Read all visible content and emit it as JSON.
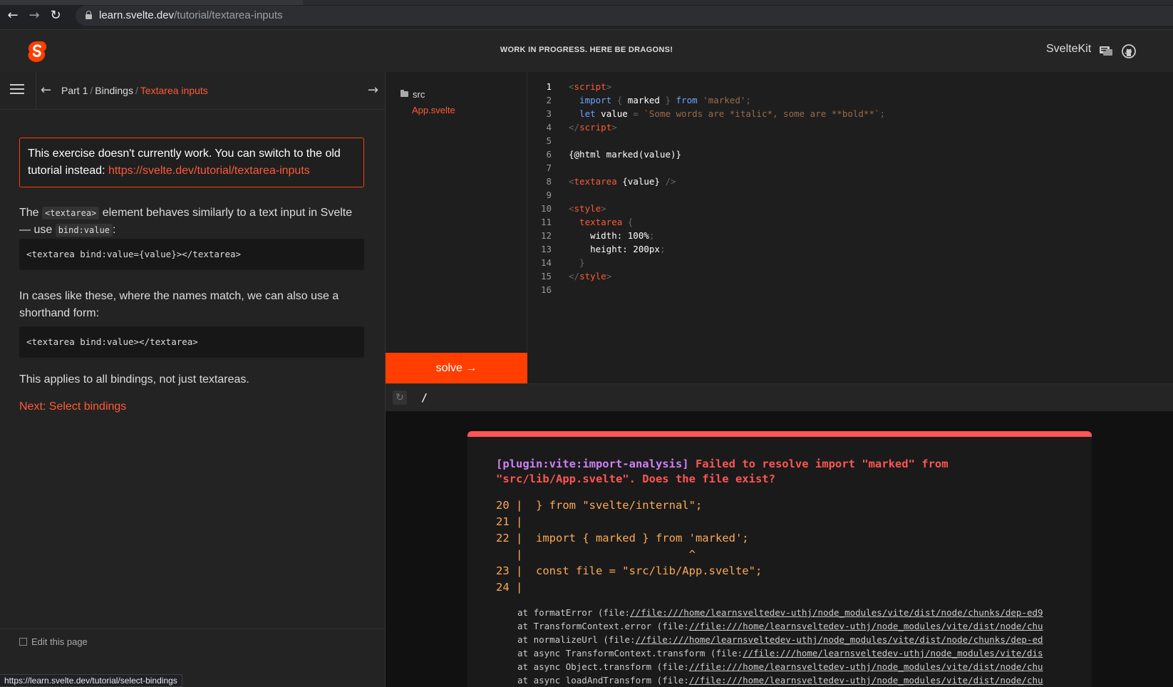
{
  "browser": {
    "url_host": "learn.svelte.dev",
    "url_path": "/tutorial/textarea-inputs",
    "status_url": "https://learn.svelte.dev/tutorial/select-bindings"
  },
  "header": {
    "banner": "WORK IN PROGRESS. HERE BE DRAGONS!",
    "sveltekit_label": "SvelteKit"
  },
  "breadcrumb": {
    "part": "Part 1",
    "section": "Bindings",
    "current": "Textarea inputs"
  },
  "lesson": {
    "warning_text": "This exercise doesn't currently work. You can switch to the old tutorial instead: ",
    "warning_link": "https://svelte.dev/tutorial/textarea-inputs",
    "p1_before": "The ",
    "p1_code1": "<textarea>",
    "p1_mid": " element behaves similarly to a text input in Svelte — use ",
    "p1_code2": "bind:value",
    "p1_after": ":",
    "code1": "<textarea bind:value={value}></textarea>",
    "p2": "In cases like these, where the names match, we can also use a shorthand form:",
    "code2": "<textarea bind:value></textarea>",
    "p3": "This applies to all bindings, not just textareas.",
    "next": "Next: Select bindings",
    "edit": "Edit this page"
  },
  "filetree": {
    "folder": "src",
    "file": "App.svelte",
    "solve": "solve →"
  },
  "editor": {
    "line_numbers": [
      "1",
      "2",
      "3",
      "4",
      "5",
      "6",
      "7",
      "8",
      "9",
      "10",
      "11",
      "12",
      "13",
      "14",
      "15",
      "16"
    ],
    "l1a": "<",
    "l1b": "script",
    "l1c": ">",
    "l2a": "  import",
    "l2b": " { ",
    "l2c": "marked",
    "l2d": " } ",
    "l2e": "from",
    "l2f": " 'marked'",
    "l2g": ";",
    "l3a": "  let",
    "l3b": " value",
    "l3c": " = ",
    "l3d": "`Some words are *italic*, some are **bold**`",
    "l3e": ";",
    "l4a": "</",
    "l4b": "script",
    "l4c": ">",
    "l6": "{@html marked(value)}",
    "l8a": "<",
    "l8b": "textarea",
    "l8c": " {value} ",
    "l8d": "/>",
    "l10a": "<",
    "l10b": "style",
    "l10c": ">",
    "l11a": "  textarea",
    "l11b": " {",
    "l12a": "    width: 100%",
    "l12b": ";",
    "l13a": "    height: 200px",
    "l13b": ";",
    "l14": "  }",
    "l15a": "</",
    "l15b": "style",
    "l15c": ">"
  },
  "preview": {
    "path": "/",
    "plugin": "[plugin:vite:import-analysis]",
    "message": " Failed to resolve import \"marked\" from \"src/lib/App.svelte\". Does the file exist?",
    "frame": [
      "20 |  } from \"svelte/internal\";",
      "21 |",
      "22 |  import { marked } from 'marked';",
      "   |                         ^",
      "23 |  const file = \"src/lib/App.svelte\";",
      "24 |"
    ],
    "stack": [
      {
        "pre": "at formatError (file:",
        "link": "//file:///home/learnsveltedev-uthj/node_modules/vite/dist/node/chunks/dep-ed9"
      },
      {
        "pre": "at TransformContext.error (file:",
        "link": "//file:///home/learnsveltedev-uthj/node_modules/vite/dist/node/chu"
      },
      {
        "pre": "at normalizeUrl (file:",
        "link": "//file:///home/learnsveltedev-uthj/node_modules/vite/dist/node/chunks/dep-ed"
      },
      {
        "pre": "at async TransformContext.transform (file:",
        "link": "//file:///home/learnsveltedev-uthj/node_modules/vite/dis"
      },
      {
        "pre": "at async Object.transform (file:",
        "link": "//file:///home/learnsveltedev-uthj/node_modules/vite/dist/node/chu"
      },
      {
        "pre": "at async loadAndTransform (file:",
        "link": "//file:///home/learnsveltedev-uthj/node_modules/vite/dist/node/chu"
      }
    ]
  }
}
